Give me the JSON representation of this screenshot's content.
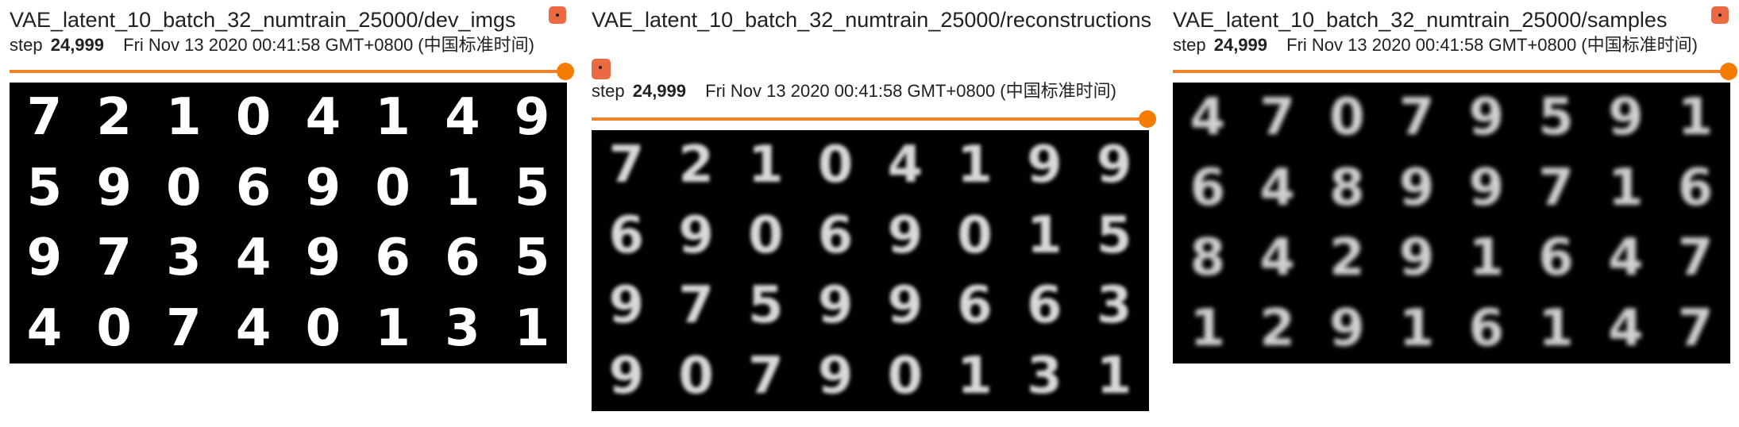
{
  "cards": [
    {
      "title": "VAE_latent_10_batch_32_numtrain_25000/dev_imgs",
      "step_label": "step",
      "step_value": "24,999",
      "timestamp": "Fri Nov 13 2020 00:41:58 GMT+0800 (中国标准时间)",
      "slider_fraction": 1.0,
      "digits": [
        "7",
        "2",
        "1",
        "0",
        "4",
        "1",
        "4",
        "9",
        "5",
        "9",
        "0",
        "6",
        "9",
        "0",
        "1",
        "5",
        "9",
        "7",
        "3",
        "4",
        "9",
        "6",
        "6",
        "5",
        "4",
        "0",
        "7",
        "4",
        "0",
        "1",
        "3",
        "1"
      ]
    },
    {
      "title": "VAE_latent_10_batch_32_numtrain_25000/reconstructions",
      "step_label": "step",
      "step_value": "24,999",
      "timestamp": "Fri Nov 13 2020 00:41:58 GMT+0800 (中国标准时间)",
      "slider_fraction": 1.0,
      "digits": [
        "7",
        "2",
        "1",
        "0",
        "4",
        "1",
        "9",
        "9",
        "6",
        "9",
        "0",
        "6",
        "9",
        "0",
        "1",
        "5",
        "9",
        "7",
        "5",
        "9",
        "9",
        "6",
        "6",
        "3",
        "9",
        "0",
        "7",
        "9",
        "0",
        "1",
        "3",
        "1"
      ]
    },
    {
      "title": "VAE_latent_10_batch_32_numtrain_25000/samples",
      "step_label": "step",
      "step_value": "24,999",
      "timestamp": "Fri Nov 13 2020 00:41:58 GMT+0800 (中国标准时间)",
      "slider_fraction": 1.0,
      "digits": [
        "4",
        "7",
        "0",
        "7",
        "9",
        "5",
        "9",
        "1",
        "6",
        "4",
        "8",
        "9",
        "9",
        "7",
        "1",
        "6",
        "8",
        "4",
        "2",
        "9",
        "1",
        "6",
        "4",
        "7",
        "1",
        "2",
        "9",
        "1",
        "6",
        "1",
        "4",
        "7"
      ]
    }
  ],
  "colors": {
    "accent": "#f57c00",
    "pin": "#ec6a43",
    "image_bg": "#000000"
  },
  "icons": {
    "pin": "pin-icon"
  }
}
